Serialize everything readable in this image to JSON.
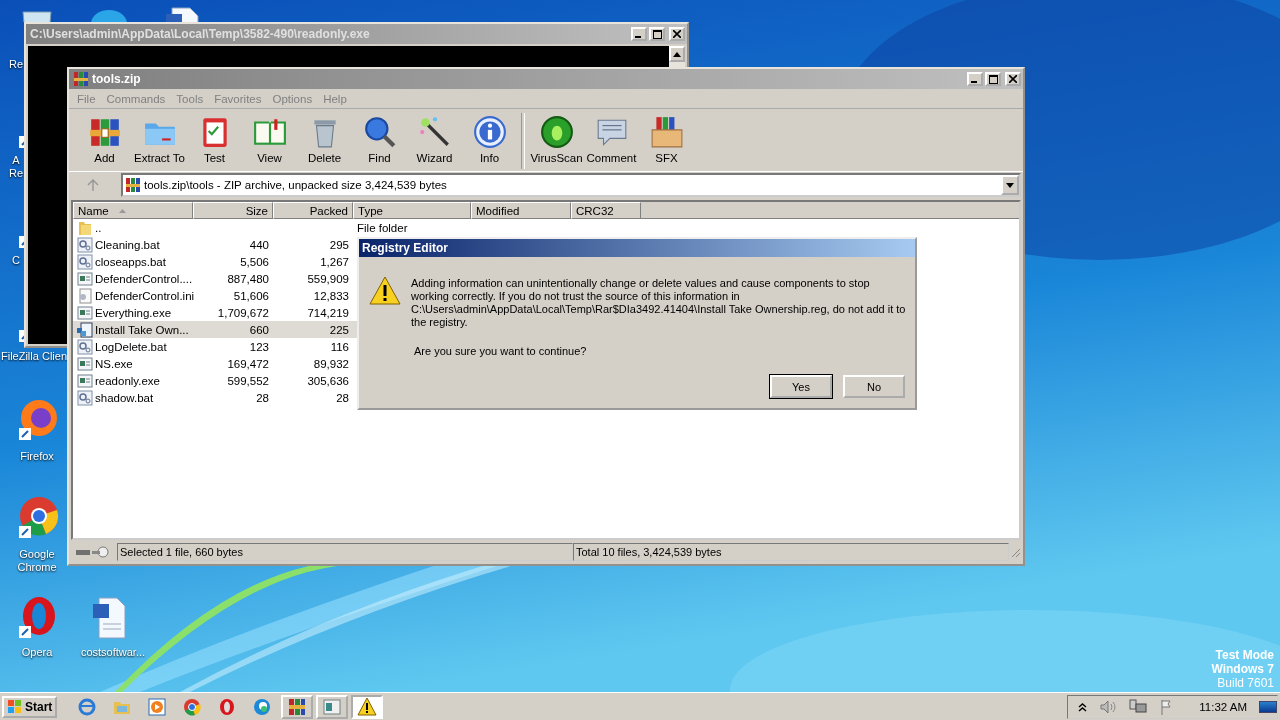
{
  "desktop": {
    "icons": [
      {
        "kind": "recycle",
        "label_lines": [
          "Re"
        ]
      },
      {
        "kind": "skype"
      },
      {
        "kind": "document"
      },
      {
        "kind": "acrobat",
        "label_lines": [
          "A",
          "Re"
        ]
      },
      {
        "kind": "shortcut",
        "label_lines": [
          "C"
        ]
      },
      {
        "kind": "filezilla",
        "label_lines": [
          "FileZilla Clien"
        ]
      },
      {
        "kind": "firefox",
        "label_lines": [
          "Firefox"
        ]
      },
      {
        "kind": "chrome",
        "label_lines": [
          "Google",
          "Chrome"
        ]
      },
      {
        "kind": "opera",
        "label_lines": [
          "Opera"
        ]
      },
      {
        "kind": "word",
        "label_lines": [
          "costsoftwar..."
        ]
      }
    ]
  },
  "console_window": {
    "title": "C:\\Users\\admin\\AppData\\Local\\Temp\\3582-490\\readonly.exe"
  },
  "archiver_window": {
    "title": "tools.zip",
    "menu": [
      {
        "label": "File",
        "disabled": true
      },
      {
        "label": "Commands",
        "disabled": true
      },
      {
        "label": "Tools",
        "disabled": true
      },
      {
        "label": "Favorites",
        "disabled": true
      },
      {
        "label": "Options",
        "disabled": true
      },
      {
        "label": "Help",
        "disabled": true
      }
    ],
    "toolbar_groups": [
      [
        {
          "kind": "add",
          "label": "Add"
        },
        {
          "kind": "extract",
          "label": "Extract To"
        },
        {
          "kind": "test",
          "label": "Test"
        },
        {
          "kind": "view",
          "label": "View"
        },
        {
          "kind": "delete",
          "label": "Delete"
        },
        {
          "kind": "find",
          "label": "Find"
        },
        {
          "kind": "wizard",
          "label": "Wizard"
        },
        {
          "kind": "info",
          "label": "Info"
        }
      ],
      [
        {
          "kind": "virusscan",
          "label": "VirusScan"
        },
        {
          "kind": "comment",
          "label": "Comment"
        },
        {
          "kind": "sfx",
          "label": "SFX"
        }
      ]
    ],
    "address": "tools.zip\\tools - ZIP archive, unpacked size 3,424,539 bytes",
    "columns": [
      {
        "label": "Name",
        "sorted": true
      },
      {
        "label": "Size",
        "sorted": false
      },
      {
        "label": "Packed",
        "sorted": false
      },
      {
        "label": "Type",
        "sorted": false
      },
      {
        "label": "Modified",
        "sorted": false
      },
      {
        "label": "CRC32",
        "sorted": false
      }
    ],
    "rows": [
      {
        "kind": "folder",
        "name": "..",
        "type": "File folder",
        "selected": false
      },
      {
        "kind": "bat",
        "name": "Cleaning.bat",
        "size": "440",
        "packed": "295",
        "selected": false
      },
      {
        "kind": "bat",
        "name": "closeapps.bat",
        "size": "5,506",
        "packed": "1,267",
        "selected": false
      },
      {
        "kind": "exe",
        "name": "DefenderControl....",
        "size": "887,480",
        "packed": "559,909",
        "selected": false
      },
      {
        "kind": "ini",
        "name": "DefenderControl.ini",
        "size": "51,606",
        "packed": "12,833",
        "selected": false
      },
      {
        "kind": "exe",
        "name": "Everything.exe",
        "size": "1,709,672",
        "packed": "714,219",
        "selected": false
      },
      {
        "kind": "reg",
        "name": "Install Take Own...",
        "size": "660",
        "packed": "225",
        "selected": true
      },
      {
        "kind": "bat",
        "name": "LogDelete.bat",
        "size": "123",
        "packed": "116",
        "selected": false
      },
      {
        "kind": "exe",
        "name": "NS.exe",
        "size": "169,472",
        "packed": "89,932",
        "selected": false
      },
      {
        "kind": "exe",
        "name": "readonly.exe",
        "size": "599,552",
        "packed": "305,636",
        "selected": false
      },
      {
        "kind": "bat",
        "name": "shadow.bat",
        "size": "28",
        "packed": "28",
        "selected": false
      }
    ],
    "status_left": "Selected 1 file, 660 bytes",
    "status_right": "Total 10 files, 3,424,539 bytes"
  },
  "dialog": {
    "title": "Registry Editor",
    "message": "Adding information can unintentionally change or delete values and cause components to stop working correctly. If you do not trust the source of this information in C:\\Users\\admin\\AppData\\Local\\Temp\\Rar$DIa3492.41404\\Install Take Ownership.reg, do not add it to the registry.",
    "question": "Are you sure you want to continue?",
    "buttons": [
      {
        "label": "Yes",
        "default": true
      },
      {
        "label": "No",
        "default": false
      }
    ]
  },
  "taskbar": {
    "start": "Start",
    "items": [
      {
        "kind": "ie",
        "open": false,
        "selected": false
      },
      {
        "kind": "explorer",
        "open": false,
        "selected": false
      },
      {
        "kind": "media",
        "open": false,
        "selected": false
      },
      {
        "kind": "chrome",
        "open": false,
        "selected": false
      },
      {
        "kind": "opera",
        "open": false,
        "selected": false
      },
      {
        "kind": "edge",
        "open": false,
        "selected": false
      },
      {
        "kind": "archiver",
        "open": true,
        "selected": false
      },
      {
        "kind": "console",
        "open": true,
        "selected": false
      },
      {
        "kind": "warning",
        "open": true,
        "selected": true
      }
    ],
    "clock": "11:32 AM"
  },
  "os_notice": [
    "Test Mode",
    "Windows 7",
    "Build 7601"
  ]
}
